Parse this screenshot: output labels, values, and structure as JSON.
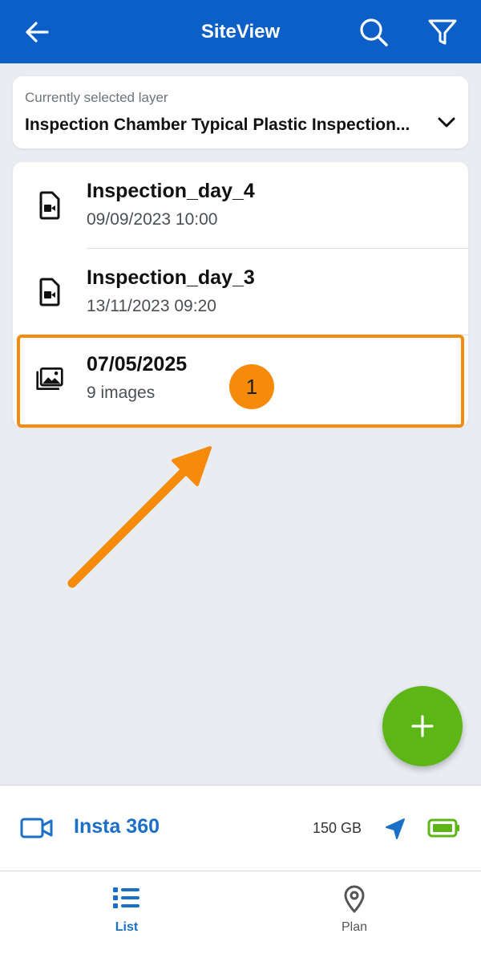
{
  "header": {
    "title": "SiteView",
    "icons": [
      "arrow-back-icon",
      "search-icon",
      "filter-icon"
    ]
  },
  "layer": {
    "caption": "Currently selected layer",
    "value": "Inspection Chamber Typical Plastic Inspection..."
  },
  "items": [
    {
      "title": "Inspection_day_4",
      "subtitle": "09/09/2023 10:00",
      "icon": "video-file-icon"
    },
    {
      "title": "Inspection_day_3",
      "subtitle": "13/11/2023 09:20",
      "icon": "video-file-icon"
    },
    {
      "title": "07/05/2025",
      "subtitle": "9 images",
      "icon": "image-gallery-icon"
    }
  ],
  "annotation": {
    "badge": "1",
    "color": "#f58a0b"
  },
  "device": {
    "name": "Insta 360",
    "storage": "150 GB",
    "icons": [
      "video-camera-icon",
      "navigation-arrow-icon",
      "battery-icon"
    ]
  },
  "nav": {
    "list_label": "List",
    "plan_label": "Plan"
  },
  "colors": {
    "header": "#0b5fc6",
    "accent": "#1b6fc7",
    "fab": "#5cb615",
    "battery": "#5cb615",
    "highlight": "#f58a0b"
  }
}
